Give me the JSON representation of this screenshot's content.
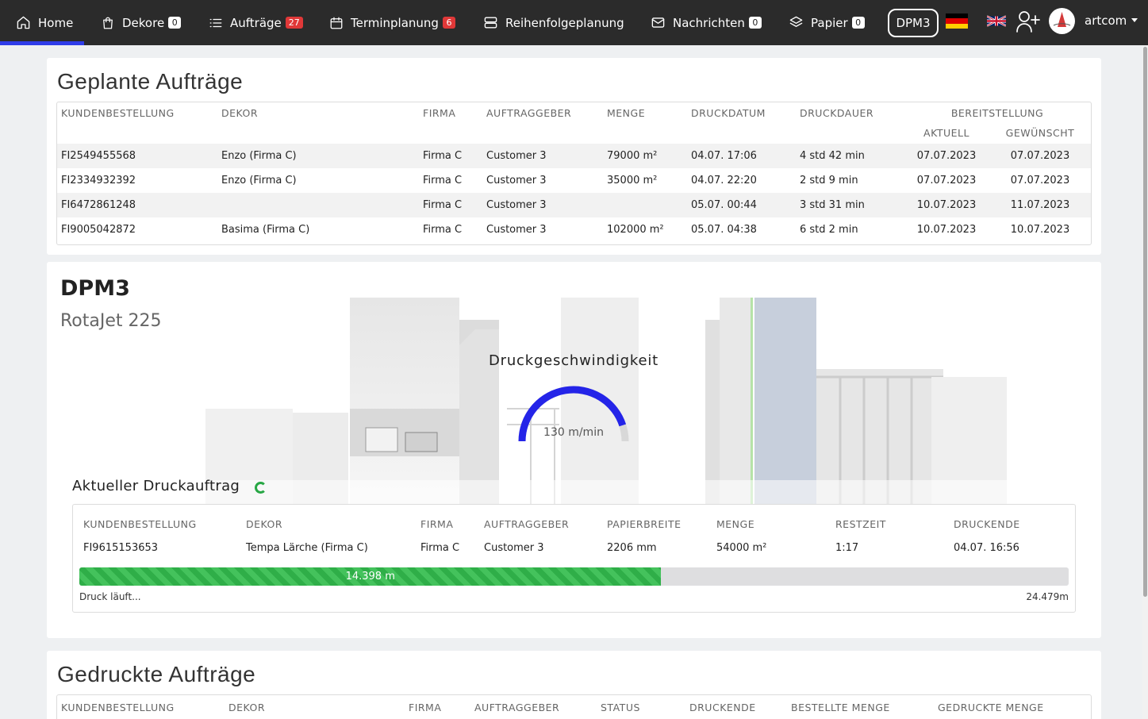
{
  "nav": {
    "items": [
      {
        "label": "Home",
        "icon": "home-icon",
        "badge": null
      },
      {
        "label": "Dekore",
        "icon": "shopping-bag-icon",
        "badge": "0"
      },
      {
        "label": "Aufträge",
        "icon": "list-icon",
        "badge": "27"
      },
      {
        "label": "Terminplanung",
        "icon": "calendar-icon",
        "badge": "6"
      },
      {
        "label": "Reihenfolgeplanung",
        "icon": "server-icon",
        "badge": null
      },
      {
        "label": "Nachrichten",
        "icon": "mail-icon",
        "badge": "0"
      },
      {
        "label": "Papier",
        "icon": "layers-icon",
        "badge": "0"
      }
    ],
    "machine_button": "DPM3",
    "user_name": "artcom",
    "colors": {
      "bg": "#2b2b2b",
      "active_underline": "#2f3ce8",
      "badge_red": "#e03838"
    }
  },
  "planned": {
    "title": "Geplante Aufträge",
    "headers": {
      "order": "KUNDENBESTELLUNG",
      "decor": "DEKOR",
      "company": "FIRMA",
      "client": "AUFTRAGGEBER",
      "qty": "MENGE",
      "print_date": "DRUCKDATUM",
      "duration": "DRUCKDAUER",
      "provision": "BEREITSTELLUNG",
      "current": "AKTUELL",
      "desired": "GEWÜNSCHT"
    },
    "rows": [
      {
        "order": "FI2549455568",
        "decor": "Enzo (Firma C)",
        "company": "Firma C",
        "client": "Customer 3",
        "qty": "79000 m²",
        "print_date": "04.07. 17:06",
        "duration": "4 std 42 min",
        "current": "07.07.2023",
        "desired": "07.07.2023"
      },
      {
        "order": "FI2334932392",
        "decor": "Enzo (Firma C)",
        "company": "Firma C",
        "client": "Customer 3",
        "qty": "35000 m²",
        "print_date": "04.07. 22:20",
        "duration": "2 std 9 min",
        "current": "07.07.2023",
        "desired": "07.07.2023"
      },
      {
        "order": "FI6472861248",
        "decor": "",
        "company": "Firma C",
        "client": "Customer 3",
        "qty": "",
        "print_date": "05.07. 00:44",
        "duration": "3 std 31 min",
        "current": "10.07.2023",
        "desired": "11.07.2023"
      },
      {
        "order": "FI9005042872",
        "decor": "Basima (Firma C)",
        "company": "Firma C",
        "client": "Customer 3",
        "qty": "102000 m²",
        "print_date": "05.07. 04:38",
        "duration": "6 std 2 min",
        "current": "10.07.2023",
        "desired": "10.07.2023"
      }
    ]
  },
  "machine": {
    "name": "DPM3",
    "model": "RotaJet 225",
    "gauge_title": "Druckgeschwindigkeit",
    "gauge_value": "130 m/min",
    "gauge_fraction": 0.9,
    "gauge_color": "#2424e8"
  },
  "current_job": {
    "title": "Aktueller Druckauftrag",
    "headers": {
      "order": "KUNDENBESTELLUNG",
      "decor": "DEKOR",
      "company": "FIRMA",
      "client": "AUFTRAGGEBER",
      "paper_width": "PAPIERBREITE",
      "qty": "MENGE",
      "remaining": "RESTZEIT",
      "print_end": "DRUCKENDE"
    },
    "row": {
      "order": "FI9615153653",
      "decor": "Tempa Lärche (Firma C)",
      "company": "Firma C",
      "client": "Customer 3",
      "paper_width": "2206 mm",
      "qty": "54000 m²",
      "remaining": "1:17",
      "print_end": "04.07. 16:56"
    },
    "progress_label": "14.398 m",
    "progress_fraction": 0.5882,
    "status": "Druck läuft...",
    "total": "24.479m",
    "progress_color": "#2fae48"
  },
  "printed": {
    "title": "Gedruckte Aufträge",
    "headers": [
      "KUNDENBESTELLUNG",
      "DEKOR",
      "FIRMA",
      "AUFTRAGGEBER",
      "STATUS",
      "DRUCKENDE",
      "BESTELLTE MENGE",
      "GEDRUCKTE MENGE"
    ]
  }
}
